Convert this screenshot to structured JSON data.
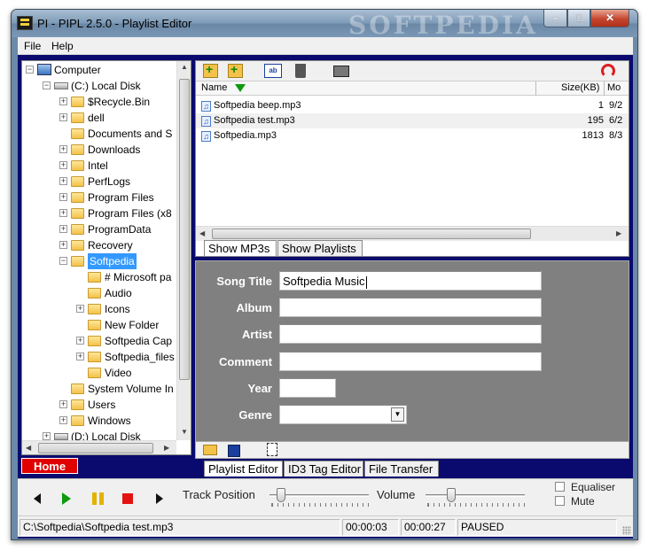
{
  "window": {
    "title": "PI - PIPL 2.5.0 - Playlist Editor",
    "watermark": "SOFTPEDIA"
  },
  "menu": {
    "items": [
      "File",
      "Help"
    ]
  },
  "tree": {
    "nodes": [
      {
        "label": "Computer",
        "level": 0,
        "icon": "computer-icon",
        "expander": "-"
      },
      {
        "label": "(C:)  Local Disk",
        "level": 1,
        "icon": "drive-icon",
        "expander": "-"
      },
      {
        "label": "$Recycle.Bin",
        "level": 2,
        "icon": "folder-icon",
        "expander": "+"
      },
      {
        "label": "dell",
        "level": 2,
        "icon": "folder-icon",
        "expander": "+"
      },
      {
        "label": "Documents and S",
        "level": 2,
        "icon": "folder-icon",
        "expander": ""
      },
      {
        "label": "Downloads",
        "level": 2,
        "icon": "folder-icon",
        "expander": "+"
      },
      {
        "label": "Intel",
        "level": 2,
        "icon": "folder-icon",
        "expander": "+"
      },
      {
        "label": "PerfLogs",
        "level": 2,
        "icon": "folder-icon",
        "expander": "+"
      },
      {
        "label": "Program Files",
        "level": 2,
        "icon": "folder-icon",
        "expander": "+"
      },
      {
        "label": "Program Files (x8",
        "level": 2,
        "icon": "folder-icon",
        "expander": "+"
      },
      {
        "label": "ProgramData",
        "level": 2,
        "icon": "folder-icon",
        "expander": "+"
      },
      {
        "label": "Recovery",
        "level": 2,
        "icon": "folder-icon",
        "expander": "+"
      },
      {
        "label": "Softpedia",
        "level": 2,
        "icon": "folder-icon",
        "expander": "-",
        "selected": true
      },
      {
        "label": "# Microsoft pa",
        "level": 3,
        "icon": "folder-icon",
        "expander": ""
      },
      {
        "label": "Audio",
        "level": 3,
        "icon": "folder-icon",
        "expander": ""
      },
      {
        "label": "Icons",
        "level": 3,
        "icon": "folder-icon",
        "expander": "+"
      },
      {
        "label": "New Folder",
        "level": 3,
        "icon": "folder-icon",
        "expander": ""
      },
      {
        "label": "Softpedia Cap",
        "level": 3,
        "icon": "folder-icon",
        "expander": "+"
      },
      {
        "label": "Softpedia_files",
        "level": 3,
        "icon": "folder-icon",
        "expander": "+"
      },
      {
        "label": "Video",
        "level": 3,
        "icon": "folder-icon",
        "expander": ""
      },
      {
        "label": "System Volume In",
        "level": 2,
        "icon": "folder-icon",
        "expander": ""
      },
      {
        "label": "Users",
        "level": 2,
        "icon": "folder-icon",
        "expander": "+"
      },
      {
        "label": "Windows",
        "level": 2,
        "icon": "folder-icon",
        "expander": "+"
      },
      {
        "label": "(D:)  Local Disk",
        "level": 1,
        "icon": "drive-icon",
        "expander": "+"
      }
    ]
  },
  "home_tab": "Home",
  "filelist": {
    "columns": {
      "name": "Name",
      "size": "Size(KB)",
      "modified": "Mo"
    },
    "rows": [
      {
        "name": "Softpedia beep.mp3",
        "size": "1",
        "modified": "9/2"
      },
      {
        "name": "Softpedia test.mp3",
        "size": "195",
        "modified": "6/2"
      },
      {
        "name": "Softpedia.mp3",
        "size": "1813",
        "modified": "8/3"
      }
    ]
  },
  "list_tabs": [
    "Show MP3s",
    "Show Playlists"
  ],
  "tag_form": {
    "labels": {
      "title": "Song Title",
      "album": "Album",
      "artist": "Artist",
      "comment": "Comment",
      "year": "Year",
      "genre": "Genre"
    },
    "values": {
      "title": "Softpedia Music",
      "album": "",
      "artist": "",
      "comment": "",
      "year": "",
      "genre": ""
    }
  },
  "bottom_tabs": [
    "Playlist Editor",
    "ID3 Tag Editor",
    "File Transfer"
  ],
  "transport": {
    "track_position_label": "Track Position",
    "volume_label": "Volume",
    "equaliser_label": "Equaliser",
    "mute_label": "Mute"
  },
  "status": {
    "path": "C:\\Softpedia\\Softpedia test.mp3",
    "elapsed": "00:00:03",
    "total": "00:00:27",
    "state": "PAUSED"
  },
  "colors": {
    "home_tab": "#e00000",
    "client_bg": "#0a0a6e",
    "tag_panel": "#808080",
    "selection": "#3399ff"
  }
}
